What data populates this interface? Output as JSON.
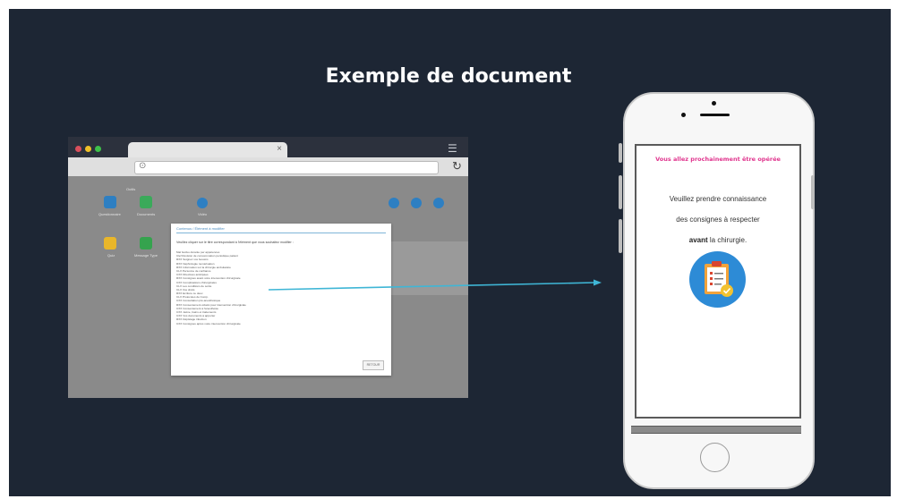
{
  "slide": {
    "title": "Exemple de document",
    "background": "#1d2634"
  },
  "browser": {
    "traffic_lights": [
      "#d94f5c",
      "#f0c028",
      "#3ec14a"
    ],
    "tab_close": "×",
    "url_icon": "⊙",
    "reload_icon": "↻",
    "menu_icon": "☰",
    "tiles_left": [
      {
        "label": "Questionnaire",
        "color": "#2e7fc2",
        "icon": "document-icon"
      },
      {
        "label": "Documents",
        "color": "#3aaa5a",
        "icon": "image-icon"
      },
      {
        "label": "Quiz",
        "color": "#e9b62a",
        "icon": "quiz-icon"
      },
      {
        "label": "Message Type",
        "color": "#35a34e",
        "icon": "message-icon"
      }
    ],
    "group_label": "Outils",
    "top_label": "Vidéo"
  },
  "modal": {
    "title": "Contenus / Élément à modifier",
    "instruction": "Veuillez cliquer sur le titre correspondant à l'élément que vous souhaitez modifier :",
    "items": [
      "Mal festivo durante per appétences",
      "Clef Revision de consommation periodique patient",
      "RXX Soignez vos besoins",
      "RXX Nephrologie numérisation",
      "RXX Information sur la chirurgie ambulatoire",
      "CLX Personne de confiance",
      "CXX Directives anticipées",
      "RXX Consignes avant votre intervention chirurgicale",
      "CXX Complications chirurgicales",
      "CLX Les conditions de sortie",
      "CLX Vos droits",
      "RXX Ecriture ce deux",
      "CLX Protocoles de Comp.",
      "CXX Consultation pré-anesthésique",
      "RXX Consentement éclairé pour intervention chirurgicale",
      "CXX Consentement à l'anesthésie",
      "CXX Jeûne, bains et traitements",
      "CXX Vos documents à apporter",
      "RXX Dépistage infection",
      "CXX Consignes après votre intervention chirurgicale"
    ],
    "button": "RETOUR"
  },
  "phone": {
    "screen_heading": "Vous allez prochainement être opérée",
    "line1": "Veuillez prendre connaissance",
    "line2": "des consignes à respecter",
    "line3_bold": "avant",
    "line3_rest": " la chirurgie.",
    "badge_icon": "clipboard-icon",
    "badge_color": "#2d8bd6"
  },
  "arrow_color": "#3fb6d6"
}
